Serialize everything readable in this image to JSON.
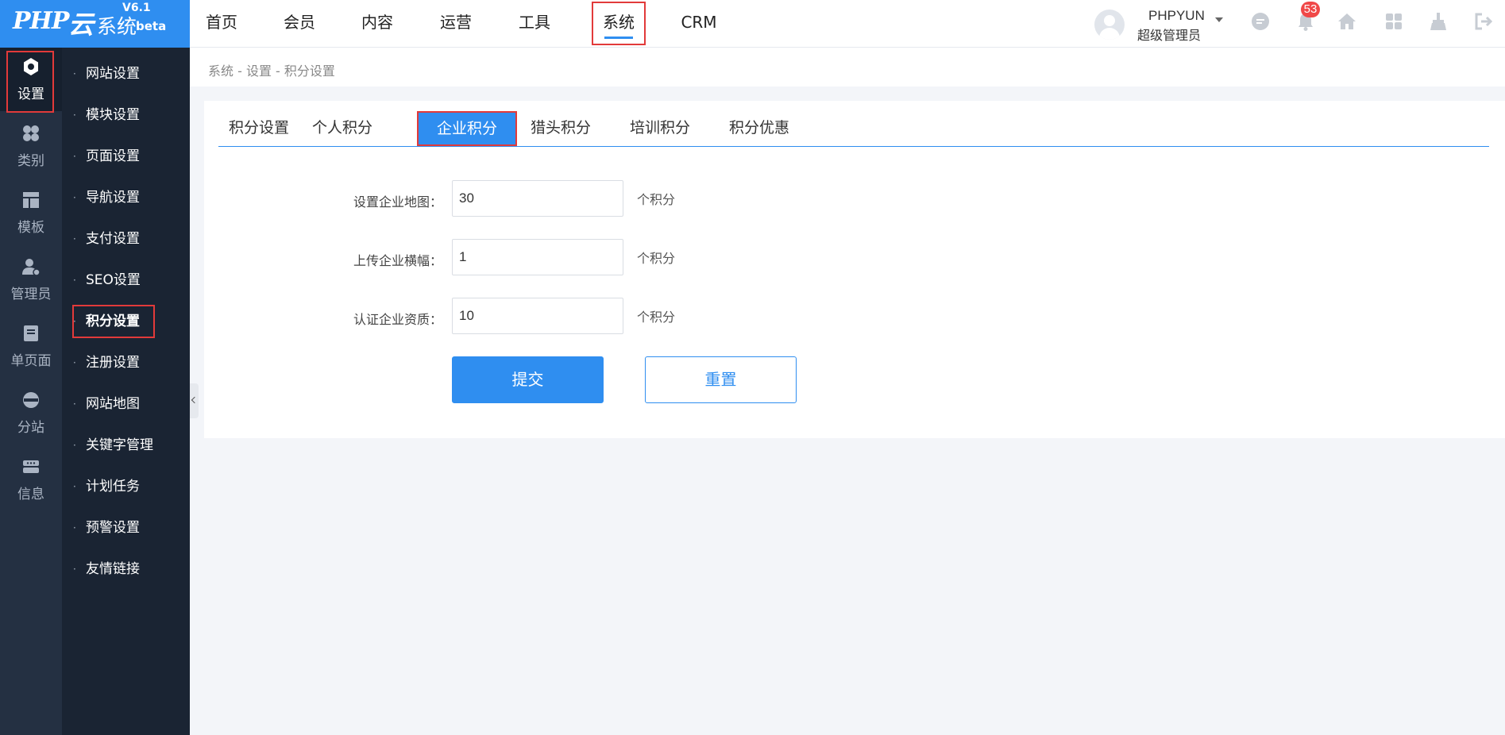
{
  "logo": {
    "php": "PHP",
    "yun": "云",
    "sys": "系统",
    "version": "V6.1",
    "beta": "beta"
  },
  "topnav": [
    "首页",
    "会员",
    "内容",
    "运营",
    "工具",
    "系统",
    "CRM"
  ],
  "active_topnav": "系统",
  "user": {
    "name": "PHPYUN",
    "role": "超级管理员"
  },
  "notifications": {
    "count": "53"
  },
  "rail": [
    "设置",
    "类别",
    "模板",
    "管理员",
    "单页面",
    "分站",
    "信息"
  ],
  "submenu": [
    "网站设置",
    "模块设置",
    "页面设置",
    "导航设置",
    "支付设置",
    "SEO设置",
    "积分设置",
    "注册设置",
    "网站地图",
    "关键字管理",
    "计划任务",
    "预警设置",
    "友情链接"
  ],
  "breadcrumb": "系统 - 设置 - 积分设置",
  "tabs": [
    "积分设置",
    "个人积分",
    "企业积分",
    "猎头积分",
    "培训积分",
    "积分优惠"
  ],
  "form": {
    "rows": [
      {
        "label": "设置企业地图：",
        "value": "30",
        "unit": "个积分"
      },
      {
        "label": "上传企业横幅：",
        "value": "1",
        "unit": "个积分"
      },
      {
        "label": "认证企业资质：",
        "value": "10",
        "unit": "个积分"
      }
    ],
    "submit": "提交",
    "reset": "重置"
  },
  "colors": {
    "primary": "#2f8ef0",
    "rail": "#243042",
    "submenu": "#1a2433",
    "highlight": "#e23a3a"
  }
}
